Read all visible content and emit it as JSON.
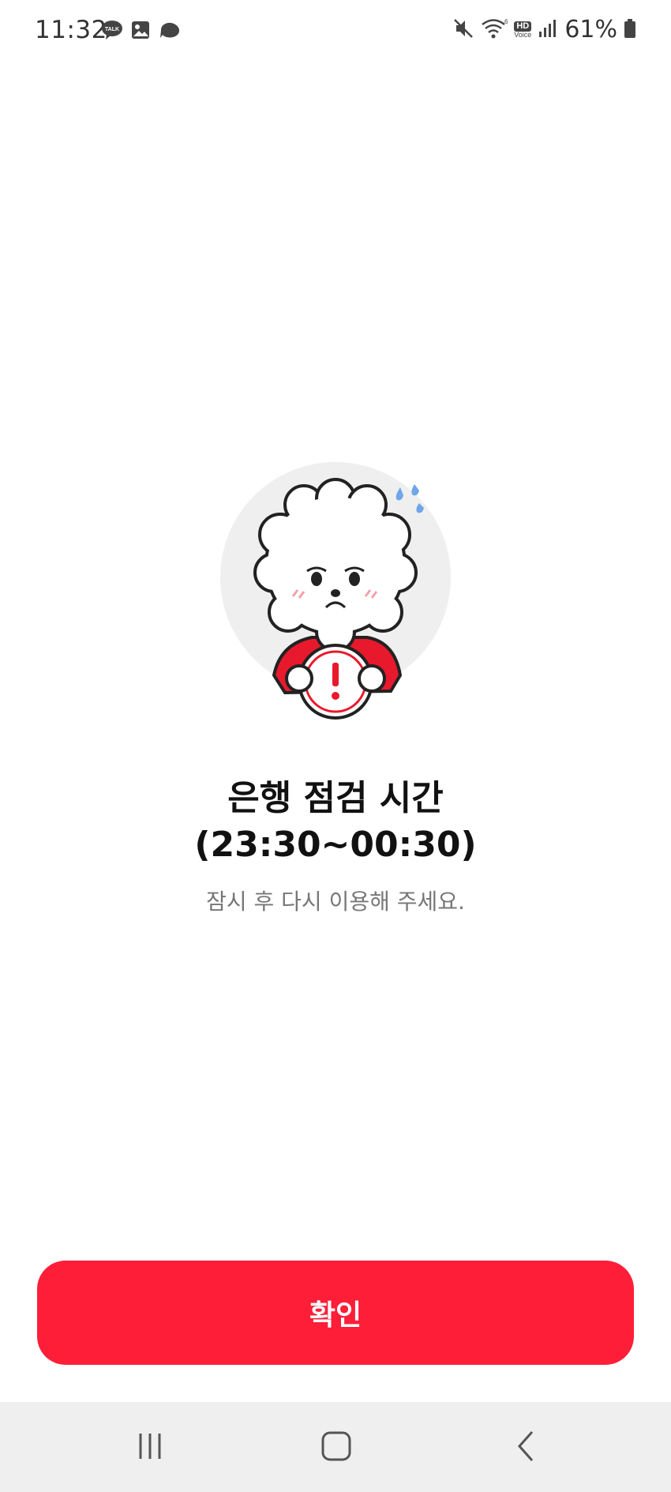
{
  "status_bar": {
    "time": "11:32",
    "notification_icons": [
      "talk-icon",
      "image-icon",
      "threads-icon"
    ],
    "system_icons": [
      "mute-icon",
      "wifi-icon",
      "hd-voice-icon",
      "signal-icon",
      "battery-icon"
    ],
    "battery_percent": "61%",
    "hd_voice_label": "HD",
    "hd_voice_sublabel": "Voice"
  },
  "main": {
    "illustration": "sad-poodle-character-holding-warning-sign",
    "title_line1": "은행 점검 시간",
    "title_line2": "(23:30~00:30)",
    "subtitle": "잠시 후 다시 이용해 주세요."
  },
  "actions": {
    "confirm_label": "확인"
  },
  "nav_bar": {
    "items": [
      "recent-apps-icon",
      "home-icon",
      "back-icon"
    ]
  },
  "colors": {
    "accent": "#fe1e38",
    "title": "#111111",
    "subtitle": "#777777",
    "nav_background": "#efefef"
  }
}
